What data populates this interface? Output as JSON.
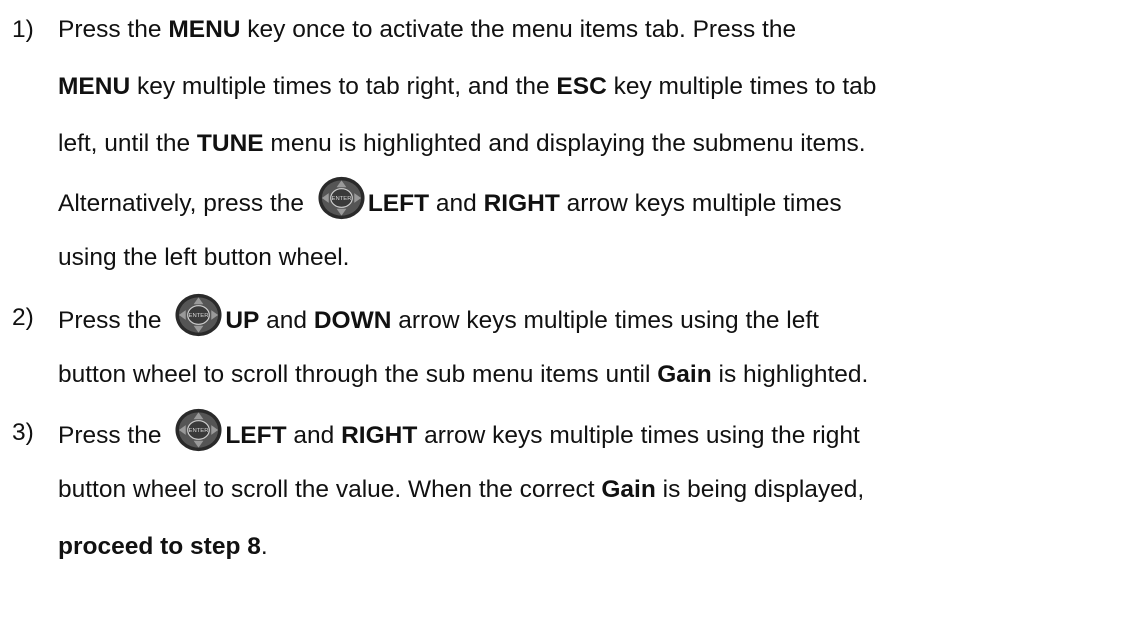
{
  "steps": [
    {
      "number": "1)",
      "lines": {
        "l1": {
          "a": "Press the ",
          "b": "MENU",
          "c": " key once to activate the menu items tab.  Press the"
        },
        "l2": {
          "a": "MENU",
          "b": " key multiple times to tab right, and the ",
          "c": "ESC",
          "d": " key multiple times to tab"
        },
        "l3": {
          "a": "left, until the ",
          "b": "TUNE",
          "c": " menu is highlighted and displaying the submenu items."
        },
        "l4": {
          "a": "Alternatively, press the ",
          "b": "LEFT",
          "c": " and ",
          "d": "RIGHT",
          "e": " arrow keys multiple times"
        },
        "l5": {
          "a": "using the left button wheel."
        }
      }
    },
    {
      "number": "2)",
      "lines": {
        "l1": {
          "a": "Press the ",
          "b": "UP",
          "c": " and ",
          "d": "DOWN",
          "e": " arrow keys multiple times using the left"
        },
        "l2": {
          "a": "button wheel to scroll through the sub menu items until ",
          "b": "Gain",
          "c": " is highlighted."
        }
      }
    },
    {
      "number": "3)",
      "lines": {
        "l1": {
          "a": "Press the ",
          "b": "LEFT",
          "c": " and ",
          "d": "RIGHT",
          "e": " arrow keys multiple times using the right"
        },
        "l2": {
          "a": "button wheel to scroll the value.  When the correct ",
          "b": "Gain",
          "c": " is being displayed,"
        },
        "l3": {
          "a": "proceed to step 8",
          "b": "."
        }
      }
    }
  ],
  "icons": {
    "wheel": "button-wheel-icon",
    "center_label": "ENTER"
  },
  "colors": {
    "text": "#111111",
    "wheel_dark": "#2a2a2a",
    "wheel_light": "#9a9a9a"
  }
}
